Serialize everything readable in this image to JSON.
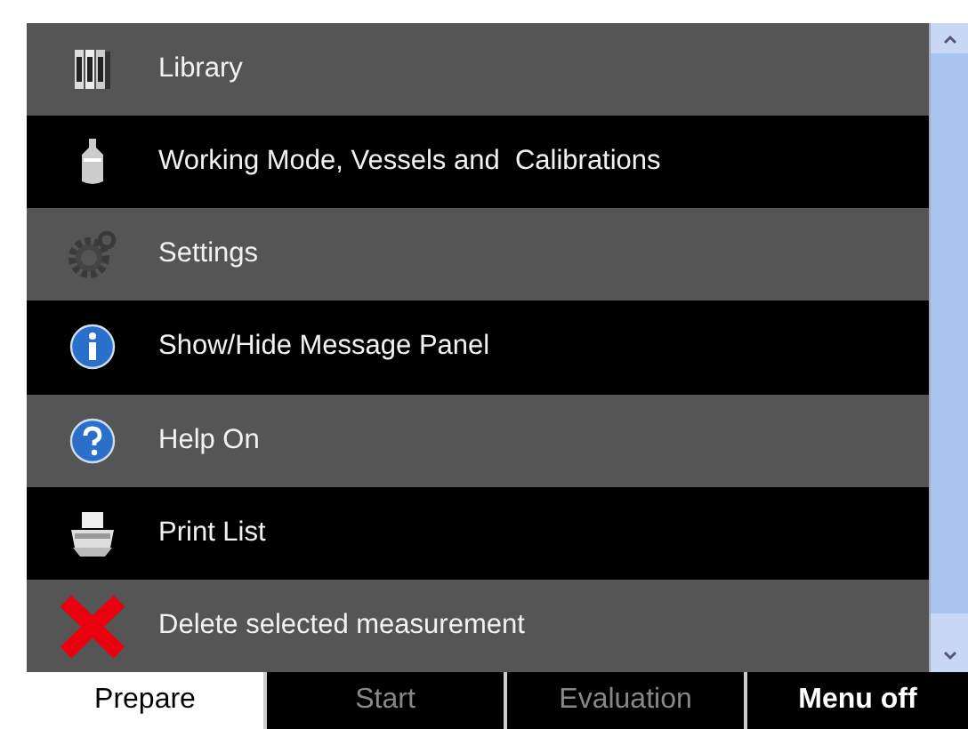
{
  "menu": {
    "items": [
      {
        "label": "Library",
        "kind": "library"
      },
      {
        "label": "Working Mode, Vessels and  Calibrations",
        "kind": "vessel"
      },
      {
        "label": "Settings",
        "kind": "gear"
      },
      {
        "label": "Show/Hide Message Panel",
        "kind": "info"
      },
      {
        "label": "Help On",
        "kind": "help"
      },
      {
        "label": "Print List",
        "kind": "printer"
      },
      {
        "label": "Delete selected measurement",
        "kind": "delete"
      }
    ]
  },
  "tabs": [
    {
      "label": "Prepare",
      "selected": true,
      "disabled": false
    },
    {
      "label": "Start",
      "selected": false,
      "disabled": true
    },
    {
      "label": "Evaluation",
      "selected": false,
      "disabled": true
    }
  ],
  "menu_button": {
    "label": "Menu off"
  }
}
